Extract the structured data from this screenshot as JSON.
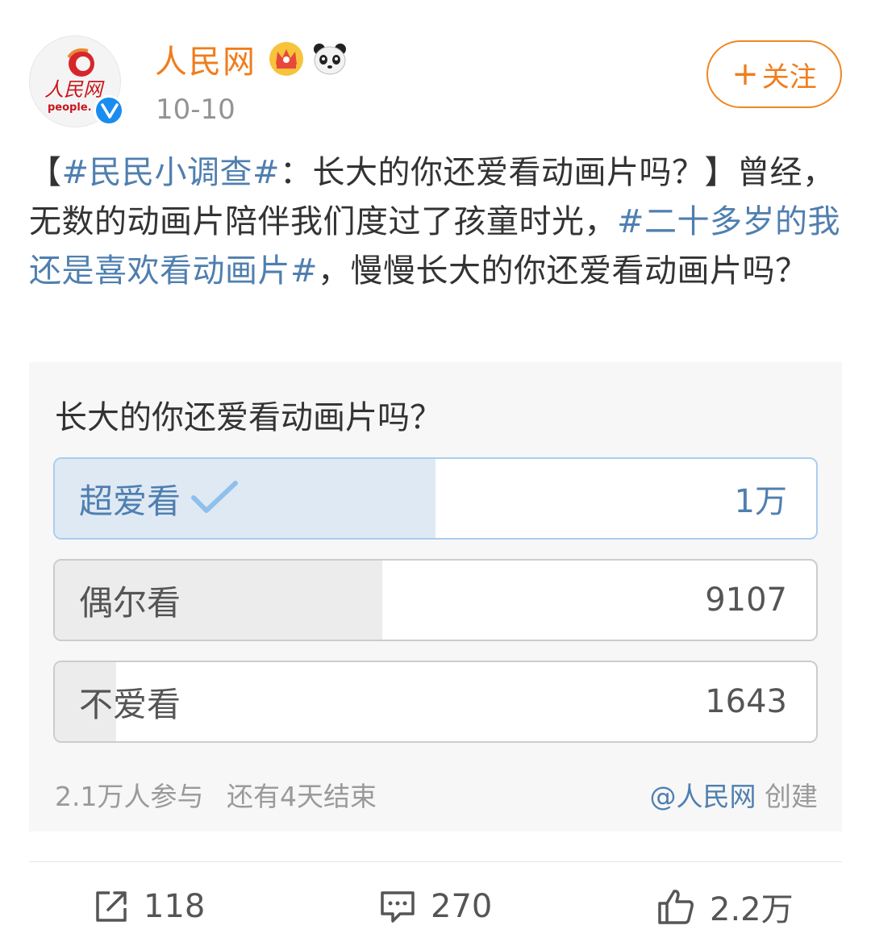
{
  "header": {
    "avatar_wordmark": "人民网",
    "avatar_subtext": "people.",
    "username": "人民网",
    "date": "10-10",
    "follow_label": "关注",
    "follow_plus": "+",
    "badges": [
      "crown-badge-icon",
      "panda-badge-icon"
    ],
    "verified_icon": "verified-v-icon"
  },
  "post": {
    "bracket_open": "【",
    "tag1": "#民民小调查#",
    "text1": "：长大的你还爱看动画片吗？】曾经，无数的动画片陪伴我们度过了孩童时光，",
    "tag2": "#二十多岁的我还是喜欢看动画片#",
    "text2": "，慢慢长大的你还爱看动画片吗？"
  },
  "poll": {
    "question": "长大的你还爱看动画片吗？",
    "options": [
      {
        "label": "超爱看",
        "count": "1万",
        "chosen": true,
        "share": 0.5
      },
      {
        "label": "偶尔看",
        "count": "9107",
        "chosen": false,
        "share": 0.43
      },
      {
        "label": "不爱看",
        "count": "1643",
        "chosen": false,
        "share": 0.08
      }
    ],
    "participants": "2.1万人参与",
    "remaining": "还有4天结束",
    "creator": "@人民网",
    "creator_suffix": " 创建"
  },
  "actions": {
    "repost_count": "118",
    "comment_count": "270",
    "like_count": "2.2万"
  },
  "colors": {
    "accent_orange": "#f07d1c",
    "link_blue": "#4f7fb0",
    "chosen_fill": "#dfe9f4",
    "verified_blue": "#1a8cf0"
  }
}
